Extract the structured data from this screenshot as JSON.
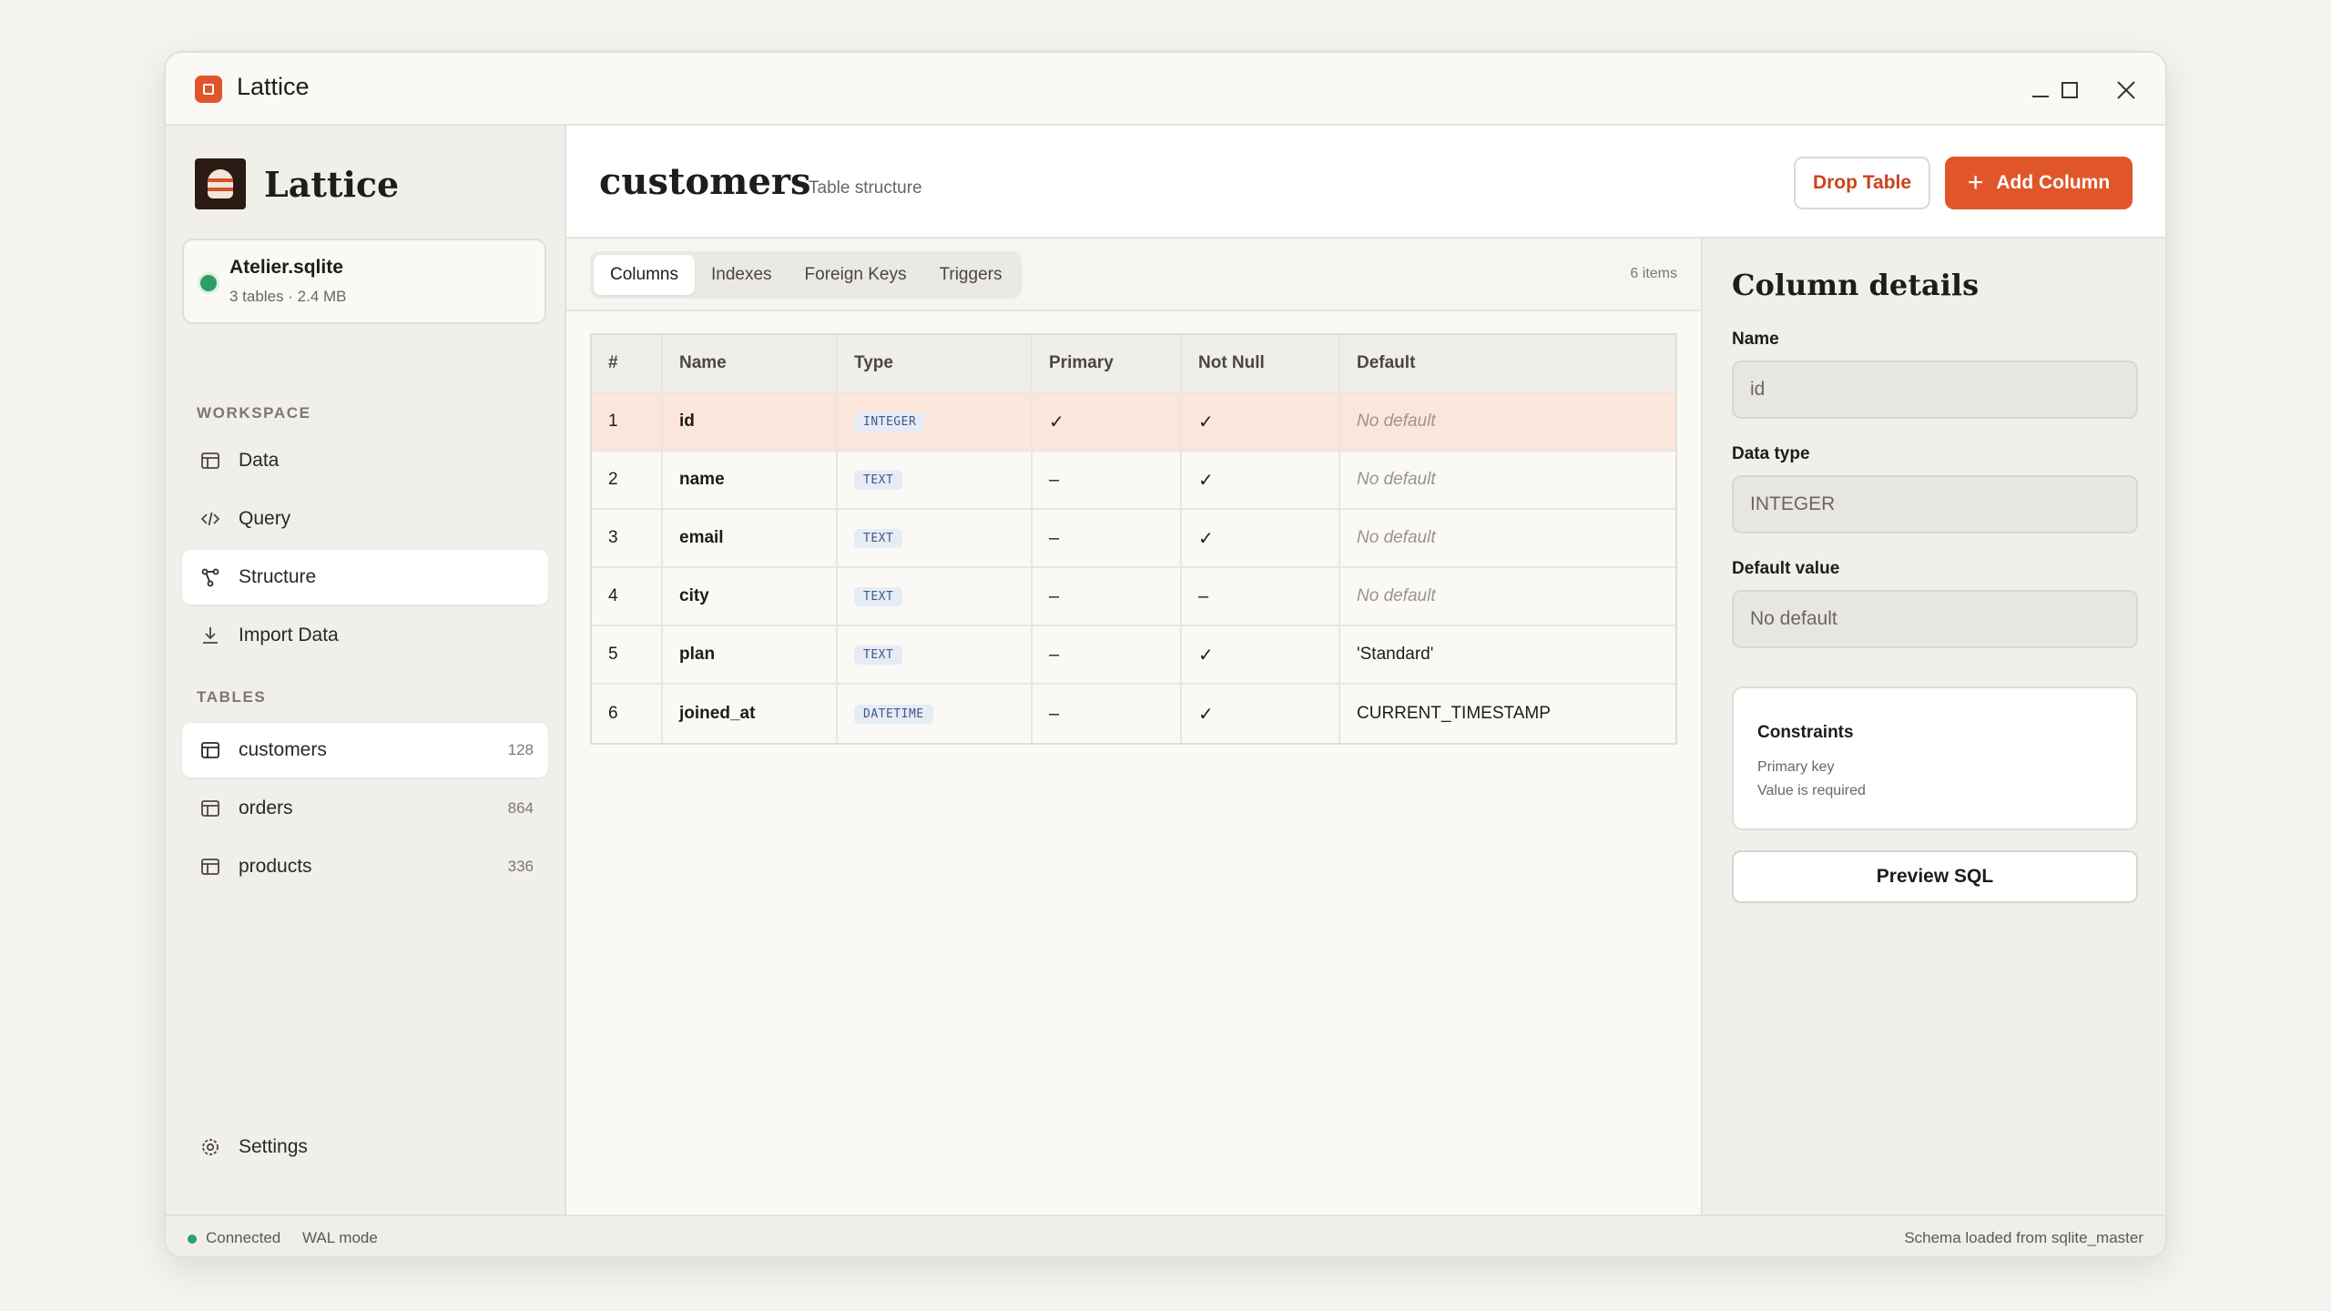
{
  "window": {
    "title": "Lattice",
    "controls": [
      "minimize",
      "maximize",
      "close"
    ]
  },
  "sidebar": {
    "brand": "Lattice",
    "database": {
      "name": "Atelier.sqlite",
      "meta": "3 tables · 2.4 MB",
      "status_color": "#2e9e63"
    },
    "workspace_label": "WORKSPACE",
    "workspace_items": [
      {
        "label": "Data",
        "icon": "table-icon"
      },
      {
        "label": "Query",
        "icon": "code-icon"
      },
      {
        "label": "Structure",
        "icon": "schema-icon",
        "active": true
      },
      {
        "label": "Import Data",
        "icon": "download-icon"
      }
    ],
    "tables_label": "TABLES",
    "tables": [
      {
        "label": "customers",
        "count": "128",
        "active": true
      },
      {
        "label": "orders",
        "count": "864"
      },
      {
        "label": "products",
        "count": "336"
      }
    ],
    "settings_label": "Settings"
  },
  "header": {
    "title": "customers",
    "subtitle": "Table structure",
    "drop_label": "Drop Table",
    "add_label": "Add Column"
  },
  "tabs": {
    "items": [
      "Columns",
      "Indexes",
      "Foreign Keys",
      "Triggers"
    ],
    "active": "Columns",
    "count": "6 items"
  },
  "table": {
    "headers": [
      "#",
      "Name",
      "Type",
      "Primary",
      "Not Null",
      "Default"
    ],
    "rows": [
      {
        "num": "1",
        "name": "id",
        "type": "INTEGER",
        "primary": "✓",
        "not_null": "✓",
        "default": "No default",
        "default_is_placeholder": true,
        "selected": true
      },
      {
        "num": "2",
        "name": "name",
        "type": "TEXT",
        "primary": "–",
        "not_null": "✓",
        "default": "No default",
        "default_is_placeholder": true
      },
      {
        "num": "3",
        "name": "email",
        "type": "TEXT",
        "primary": "–",
        "not_null": "✓",
        "default": "No default",
        "default_is_placeholder": true
      },
      {
        "num": "4",
        "name": "city",
        "type": "TEXT",
        "primary": "–",
        "not_null": "–",
        "default": "No default",
        "default_is_placeholder": true
      },
      {
        "num": "5",
        "name": "plan",
        "type": "TEXT",
        "primary": "–",
        "not_null": "✓",
        "default": "'Standard'"
      },
      {
        "num": "6",
        "name": "joined_at",
        "type": "DATETIME",
        "primary": "–",
        "not_null": "✓",
        "default": "CURRENT_TIMESTAMP"
      }
    ]
  },
  "details": {
    "title": "Column details",
    "name_label": "Name",
    "name_value": "id",
    "type_label": "Data type",
    "type_value": "INTEGER",
    "default_label": "Default value",
    "default_value": "No default",
    "constraints_title": "Constraints",
    "constraints": [
      "Primary key",
      "Value is required"
    ],
    "preview_label": "Preview SQL"
  },
  "statusbar": {
    "connection": "Connected",
    "mode": "WAL mode",
    "message": "Schema loaded from sqlite_master"
  },
  "colors": {
    "accent": "#e0562a",
    "selected_row": "#fbe6dc",
    "connected": "#2e9e63"
  }
}
